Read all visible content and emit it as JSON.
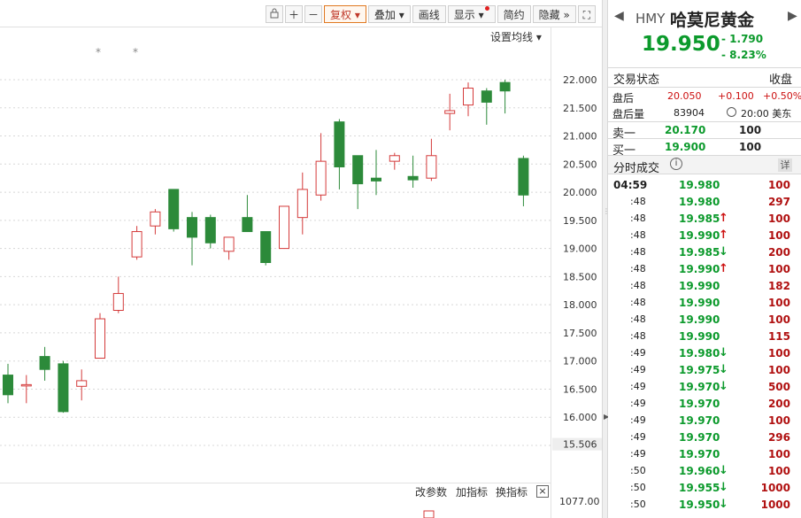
{
  "toolbar": {
    "items": [
      "复权",
      "叠加",
      "画线",
      "显示",
      "简约",
      "隐藏"
    ],
    "icons": [
      "lock-icon",
      "plus-icon",
      "minus-icon",
      "fullscreen-icon"
    ]
  },
  "chart": {
    "ma_setting": "设置均线",
    "stars": [
      "*",
      "*"
    ],
    "indicator_links": [
      "改参数",
      "加指标",
      "换指标"
    ],
    "volume_label": "1077.00",
    "price_label": "15.506"
  },
  "chart_data": {
    "type": "candlestick",
    "y_ticks": [
      "22.000",
      "21.500",
      "21.000",
      "20.500",
      "20.000",
      "19.500",
      "19.000",
      "18.500",
      "18.000",
      "17.500",
      "17.000",
      "16.500",
      "16.000",
      "15.500"
    ],
    "ylim": [
      15.5,
      22.0
    ],
    "up_color": "#d43a3a",
    "down_color": "#2c8a3a",
    "candles": [
      {
        "o": 16.75,
        "h": 16.95,
        "l": 16.25,
        "c": 16.4
      },
      {
        "o": 16.58,
        "h": 16.75,
        "l": 16.25,
        "c": 16.58
      },
      {
        "o": 17.08,
        "h": 17.25,
        "l": 16.65,
        "c": 16.85
      },
      {
        "o": 16.95,
        "h": 17.0,
        "l": 16.08,
        "c": 16.1
      },
      {
        "o": 16.55,
        "h": 16.85,
        "l": 16.3,
        "c": 16.65
      },
      {
        "o": 17.05,
        "h": 17.85,
        "l": 17.05,
        "c": 17.75
      },
      {
        "o": 17.9,
        "h": 18.5,
        "l": 17.85,
        "c": 18.2
      },
      {
        "o": 18.85,
        "h": 19.4,
        "l": 18.8,
        "c": 19.3
      },
      {
        "o": 19.4,
        "h": 19.7,
        "l": 19.25,
        "c": 19.65
      },
      {
        "o": 20.05,
        "h": 20.05,
        "l": 19.3,
        "c": 19.35
      },
      {
        "o": 19.55,
        "h": 19.65,
        "l": 18.7,
        "c": 19.2
      },
      {
        "o": 19.55,
        "h": 19.6,
        "l": 19.0,
        "c": 19.1
      },
      {
        "o": 18.95,
        "h": 19.2,
        "l": 18.8,
        "c": 19.2
      },
      {
        "o": 19.55,
        "h": 19.95,
        "l": 19.3,
        "c": 19.3
      },
      {
        "o": 19.3,
        "h": 19.3,
        "l": 18.7,
        "c": 18.75
      },
      {
        "o": 19.0,
        "h": 19.75,
        "l": 19.0,
        "c": 19.75
      },
      {
        "o": 19.55,
        "h": 20.35,
        "l": 19.25,
        "c": 20.05
      },
      {
        "o": 19.95,
        "h": 21.05,
        "l": 19.85,
        "c": 20.55
      },
      {
        "o": 21.25,
        "h": 21.3,
        "l": 20.05,
        "c": 20.45
      },
      {
        "o": 20.65,
        "h": 20.65,
        "l": 19.7,
        "c": 20.15
      },
      {
        "o": 20.25,
        "h": 20.75,
        "l": 19.95,
        "c": 20.2
      },
      {
        "o": 20.55,
        "h": 20.7,
        "l": 20.4,
        "c": 20.65
      },
      {
        "o": 20.28,
        "h": 20.65,
        "l": 20.08,
        "c": 20.22
      },
      {
        "o": 20.25,
        "h": 20.95,
        "l": 20.2,
        "c": 20.65
      },
      {
        "o": 21.4,
        "h": 21.75,
        "l": 21.1,
        "c": 21.45
      },
      {
        "o": 21.55,
        "h": 21.95,
        "l": 21.35,
        "c": 21.85
      },
      {
        "o": 21.8,
        "h": 21.85,
        "l": 21.2,
        "c": 21.6
      },
      {
        "o": 21.95,
        "h": 22.0,
        "l": 21.4,
        "c": 21.8
      },
      {
        "o": 20.6,
        "h": 20.65,
        "l": 19.75,
        "c": 19.95
      }
    ]
  },
  "quote": {
    "code": "HMY",
    "name": "哈莫尼黄金",
    "price": "19.950",
    "change": "- 1.790",
    "change_pct": "- 8.23%",
    "status_label": "交易状态",
    "status_value": "收盘",
    "after_hours_label": "盘后",
    "after_hours_price": "20.050",
    "after_hours_change": "+0.100",
    "after_hours_pct": "+0.50%",
    "after_hours_vol_label": "盘后量",
    "after_hours_vol": "83904",
    "after_hours_time": "20:00 美东",
    "ask_label": "卖一",
    "ask_price": "20.170",
    "ask_qty": "100",
    "bid_label": "买一",
    "bid_price": "19.900",
    "bid_qty": "100"
  },
  "ticks_panel": {
    "title": "分时成交",
    "detail_label": "详",
    "rows": [
      {
        "time": "04:59",
        "price": "19.980",
        "arrow": "",
        "qty": "100"
      },
      {
        "time": ":48",
        "price": "19.980",
        "arrow": "",
        "qty": "297"
      },
      {
        "time": ":48",
        "price": "19.985",
        "arrow": "↑",
        "qty": "100"
      },
      {
        "time": ":48",
        "price": "19.990",
        "arrow": "↑",
        "qty": "100"
      },
      {
        "time": ":48",
        "price": "19.985",
        "arrow": "↓",
        "qty": "200"
      },
      {
        "time": ":48",
        "price": "19.990",
        "arrow": "↑",
        "qty": "100"
      },
      {
        "time": ":48",
        "price": "19.990",
        "arrow": "",
        "qty": "182"
      },
      {
        "time": ":48",
        "price": "19.990",
        "arrow": "",
        "qty": "100"
      },
      {
        "time": ":48",
        "price": "19.990",
        "arrow": "",
        "qty": "100"
      },
      {
        "time": ":48",
        "price": "19.990",
        "arrow": "",
        "qty": "115"
      },
      {
        "time": ":49",
        "price": "19.980",
        "arrow": "↓",
        "qty": "100"
      },
      {
        "time": ":49",
        "price": "19.975",
        "arrow": "↓",
        "qty": "100"
      },
      {
        "time": ":49",
        "price": "19.970",
        "arrow": "↓",
        "qty": "500"
      },
      {
        "time": ":49",
        "price": "19.970",
        "arrow": "",
        "qty": "200"
      },
      {
        "time": ":49",
        "price": "19.970",
        "arrow": "",
        "qty": "100"
      },
      {
        "time": ":49",
        "price": "19.970",
        "arrow": "",
        "qty": "296"
      },
      {
        "time": ":49",
        "price": "19.970",
        "arrow": "",
        "qty": "100"
      },
      {
        "time": ":50",
        "price": "19.960",
        "arrow": "↓",
        "qty": "100"
      },
      {
        "time": ":50",
        "price": "19.955",
        "arrow": "↓",
        "qty": "1000"
      },
      {
        "time": ":50",
        "price": "19.950",
        "arrow": "↓",
        "qty": "1000"
      }
    ]
  }
}
